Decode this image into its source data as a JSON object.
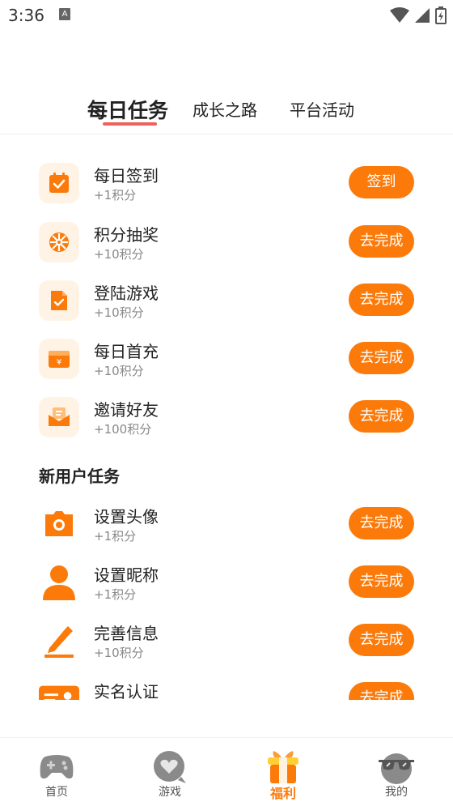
{
  "status_bar": {
    "time": "3:36",
    "notif_letter": "A"
  },
  "tabs": [
    {
      "label": "每日任务",
      "active": true
    },
    {
      "label": "成长之路",
      "active": false
    },
    {
      "label": "平台活动",
      "active": false
    }
  ],
  "daily_tasks": [
    {
      "title": "每日签到",
      "reward": "+1积分",
      "button": "签到",
      "icon": "calendar-check-icon"
    },
    {
      "title": "积分抽奖",
      "reward": "+10积分",
      "button": "去完成",
      "icon": "lottery-wheel-icon"
    },
    {
      "title": "登陆游戏",
      "reward": "+10积分",
      "button": "去完成",
      "icon": "document-check-icon"
    },
    {
      "title": "每日首充",
      "reward": "+10积分",
      "button": "去完成",
      "icon": "wallet-yen-icon"
    },
    {
      "title": "邀请好友",
      "reward": "+100积分",
      "button": "去完成",
      "icon": "envelope-icon"
    }
  ],
  "new_user_section": {
    "title": "新用户任务"
  },
  "new_user_tasks": [
    {
      "title": "设置头像",
      "reward": "+1积分",
      "button": "去完成",
      "icon": "camera-icon"
    },
    {
      "title": "设置昵称",
      "reward": "+1积分",
      "button": "去完成",
      "icon": "user-icon"
    },
    {
      "title": "完善信息",
      "reward": "+10积分",
      "button": "去完成",
      "icon": "pencil-icon"
    },
    {
      "title": "实名认证",
      "reward": "",
      "button": "去完成",
      "icon": "id-card-icon"
    }
  ],
  "bottom_nav": [
    {
      "label": "首页",
      "icon": "gamepad-icon",
      "active": false
    },
    {
      "label": "游戏",
      "icon": "heart-bubble-icon",
      "active": false
    },
    {
      "label": "福利",
      "icon": "gift-box-icon",
      "active": true
    },
    {
      "label": "我的",
      "icon": "sunglasses-face-icon",
      "active": false
    }
  ],
  "colors": {
    "accent": "#fb7a0a",
    "tab_underline": "#f0615c",
    "icon_bg": "#fff3e6"
  }
}
